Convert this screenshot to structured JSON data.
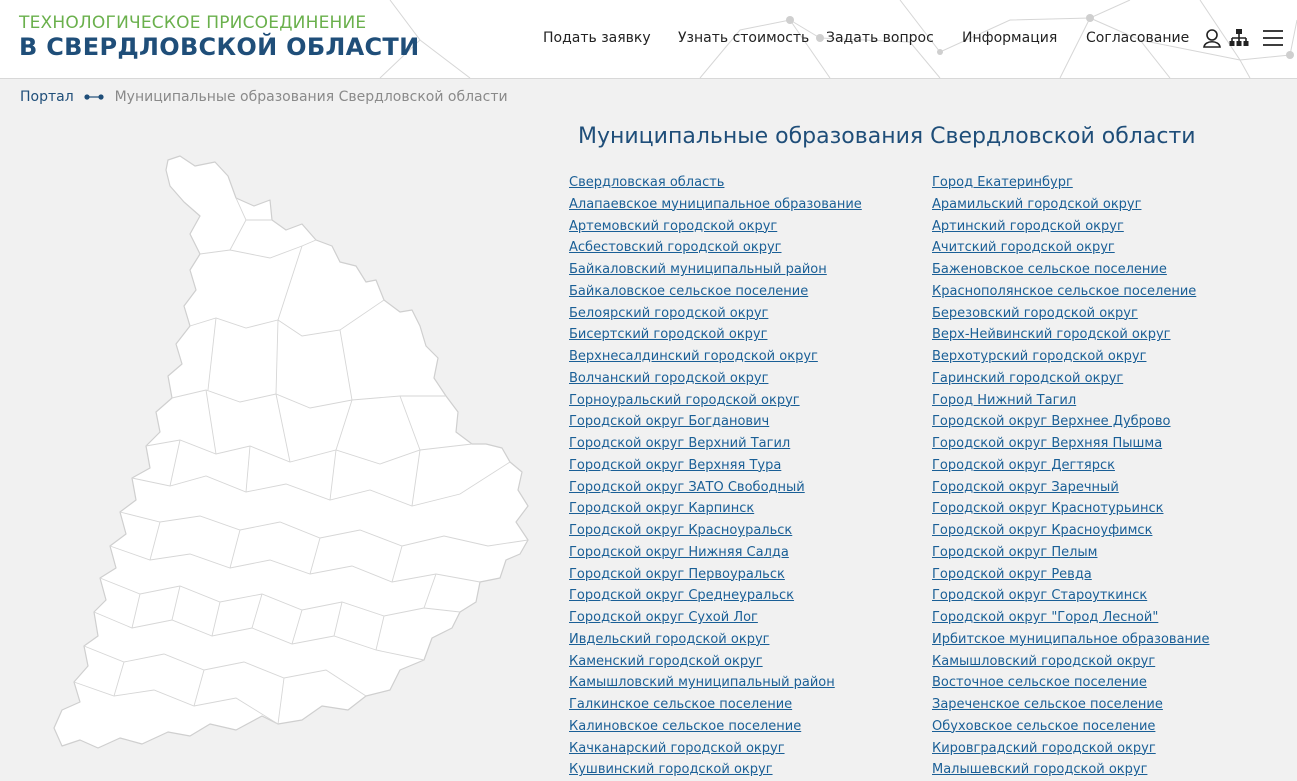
{
  "header": {
    "logo_top": "ТЕХНОЛОГИЧЕСКОЕ ПРИСОЕДИНЕНИЕ",
    "logo_bottom": "В СВЕРДЛОВСКОЙ ОБЛАСТИ",
    "nav": [
      "Подать заявку",
      "Узнать стоимость",
      "Задать вопрос",
      "Информация",
      "Согласование"
    ],
    "icons": [
      "user-icon",
      "sitemap-icon",
      "menu-icon"
    ]
  },
  "breadcrumb": {
    "home": "Портал",
    "current": "Муниципальные образования Свердловской области"
  },
  "main": {
    "title": "Муниципальные образования Свердловской области",
    "left_links": [
      "Свердловская область",
      "Алапаевское муниципальное образование",
      "Артемовский городской округ",
      "Асбестовский городской округ",
      "Байкаловский муниципальный район",
      "Байкаловское сельское поселение",
      "Белоярский городской округ",
      "Бисертский городской округ",
      "Верхнесалдинский городской округ",
      "Волчанский городской округ",
      "Горноуральский городской округ",
      "Городской округ Богданович",
      "Городской округ Верхний Тагил",
      "Городской округ Верхняя Тура",
      "Городской округ ЗАТО Свободный",
      "Городской округ Карпинск",
      "Городской округ Красноуральск",
      "Городской округ Нижняя Салда",
      "Городской округ Первоуральск",
      "Городской округ Среднеуральск",
      "Городской округ Сухой Лог",
      "Ивдельский городской округ",
      "Каменский городской округ",
      "Камышловский муниципальный район",
      "Галкинское сельское поселение",
      "Калиновское сельское поселение",
      "Качканарский городской округ",
      "Кушвинский городской округ"
    ],
    "right_links": [
      "Город Екатеринбург",
      "Арамильский городской округ",
      "Артинский городской округ",
      "Ачитский городской округ",
      "Баженовское сельское поселение",
      "Краснополянское сельское поселение",
      "Березовский городской округ",
      "Верх-Нейвинский городской округ",
      "Верхотурский городской округ",
      "Гаринский городской округ",
      "Город Нижний Тагил",
      "Городской округ Верхнее Дуброво",
      "Городской округ Верхняя Пышма",
      "Городской округ Дегтярск",
      "Городской округ Заречный",
      "Городской округ Краснотурьинск",
      "Городской округ Красноуфимск",
      "Городской округ Пелым",
      "Городской округ Ревда",
      "Городской округ Староуткинск",
      "Городской округ \"Город Лесной\"",
      "Ирбитское муниципальное образование",
      "Камышловский городской округ",
      "Восточное сельское поселение",
      "Зареченское сельское поселение",
      "Обуховское сельское поселение",
      "Кировградский городской округ",
      "Малышевский городской округ"
    ]
  },
  "colors": {
    "logo_green": "#6ab04c",
    "logo_blue": "#1f4e79",
    "link": "#1a5f96",
    "page_bg": "#f1f1f1"
  }
}
